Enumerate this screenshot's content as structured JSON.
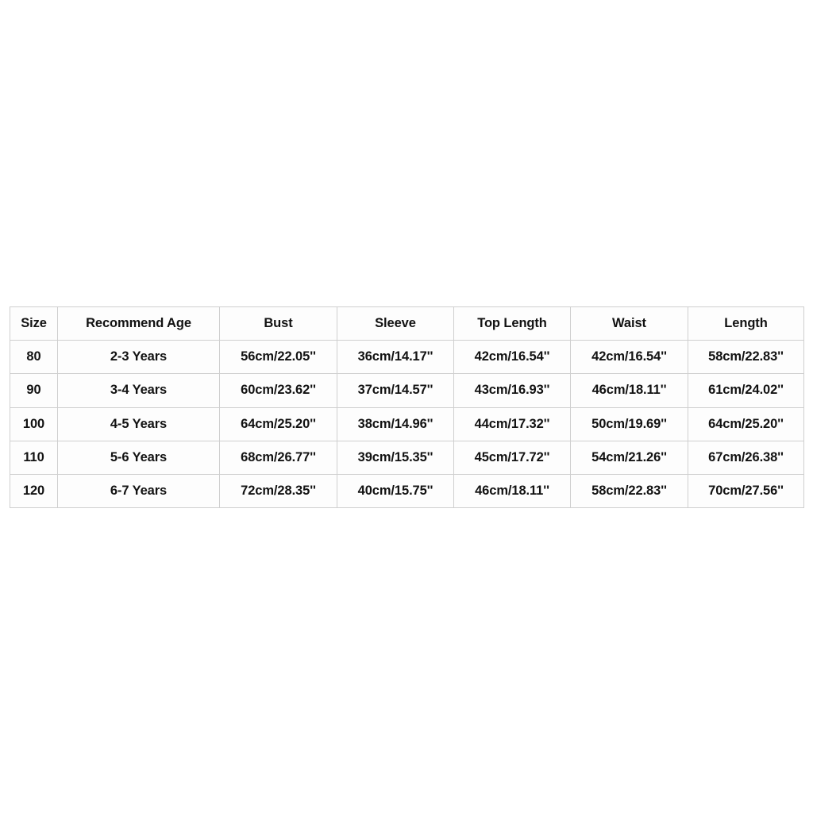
{
  "chart_data": {
    "type": "table",
    "title": "",
    "columns": [
      "Size",
      "Recommend Age",
      "Bust",
      "Sleeve",
      "Top Length",
      "Waist",
      "Length"
    ],
    "rows": [
      [
        "80",
        "2-3 Years",
        "56cm/22.05''",
        "36cm/14.17''",
        "42cm/16.54''",
        "42cm/16.54''",
        "58cm/22.83''"
      ],
      [
        "90",
        "3-4 Years",
        "60cm/23.62''",
        "37cm/14.57''",
        "43cm/16.93''",
        "46cm/18.11''",
        "61cm/24.02''"
      ],
      [
        "100",
        "4-5 Years",
        "64cm/25.20''",
        "38cm/14.96''",
        "44cm/17.32''",
        "50cm/19.69''",
        "64cm/25.20''"
      ],
      [
        "110",
        "5-6 Years",
        "68cm/26.77''",
        "39cm/15.35''",
        "45cm/17.72''",
        "54cm/21.26''",
        "67cm/26.38''"
      ],
      [
        "120",
        "6-7 Years",
        "72cm/28.35''",
        "40cm/15.75''",
        "46cm/18.11''",
        "58cm/22.83''",
        "70cm/27.56''"
      ]
    ],
    "colors": {
      "page_background": "#ffffff",
      "cell_background": "#fdfdfd",
      "border": "#cfcfcf",
      "text": "#121212"
    }
  },
  "size_chart": {
    "headers": [
      {
        "label": "Size"
      },
      {
        "label": "Recommend Age"
      },
      {
        "label": "Bust"
      },
      {
        "label": "Sleeve"
      },
      {
        "label": "Top Length"
      },
      {
        "label": "Waist"
      },
      {
        "label": "Length"
      }
    ],
    "rows": [
      {
        "size": "80",
        "age": "2-3 Years",
        "bust": "56cm/22.05''",
        "sleeve": "36cm/14.17''",
        "top_length": "42cm/16.54''",
        "waist": "42cm/16.54''",
        "length": "58cm/22.83''"
      },
      {
        "size": "90",
        "age": "3-4 Years",
        "bust": "60cm/23.62''",
        "sleeve": "37cm/14.57''",
        "top_length": "43cm/16.93''",
        "waist": "46cm/18.11''",
        "length": "61cm/24.02''"
      },
      {
        "size": "100",
        "age": "4-5 Years",
        "bust": "64cm/25.20''",
        "sleeve": "38cm/14.96''",
        "top_length": "44cm/17.32''",
        "waist": "50cm/19.69''",
        "length": "64cm/25.20''"
      },
      {
        "size": "110",
        "age": "5-6 Years",
        "bust": "68cm/26.77''",
        "sleeve": "39cm/15.35''",
        "top_length": "45cm/17.72''",
        "waist": "54cm/21.26''",
        "length": "67cm/26.38''"
      },
      {
        "size": "120",
        "age": "6-7 Years",
        "bust": "72cm/28.35''",
        "sleeve": "40cm/15.75''",
        "top_length": "46cm/18.11''",
        "waist": "58cm/22.83''",
        "length": "70cm/27.56''"
      }
    ]
  }
}
